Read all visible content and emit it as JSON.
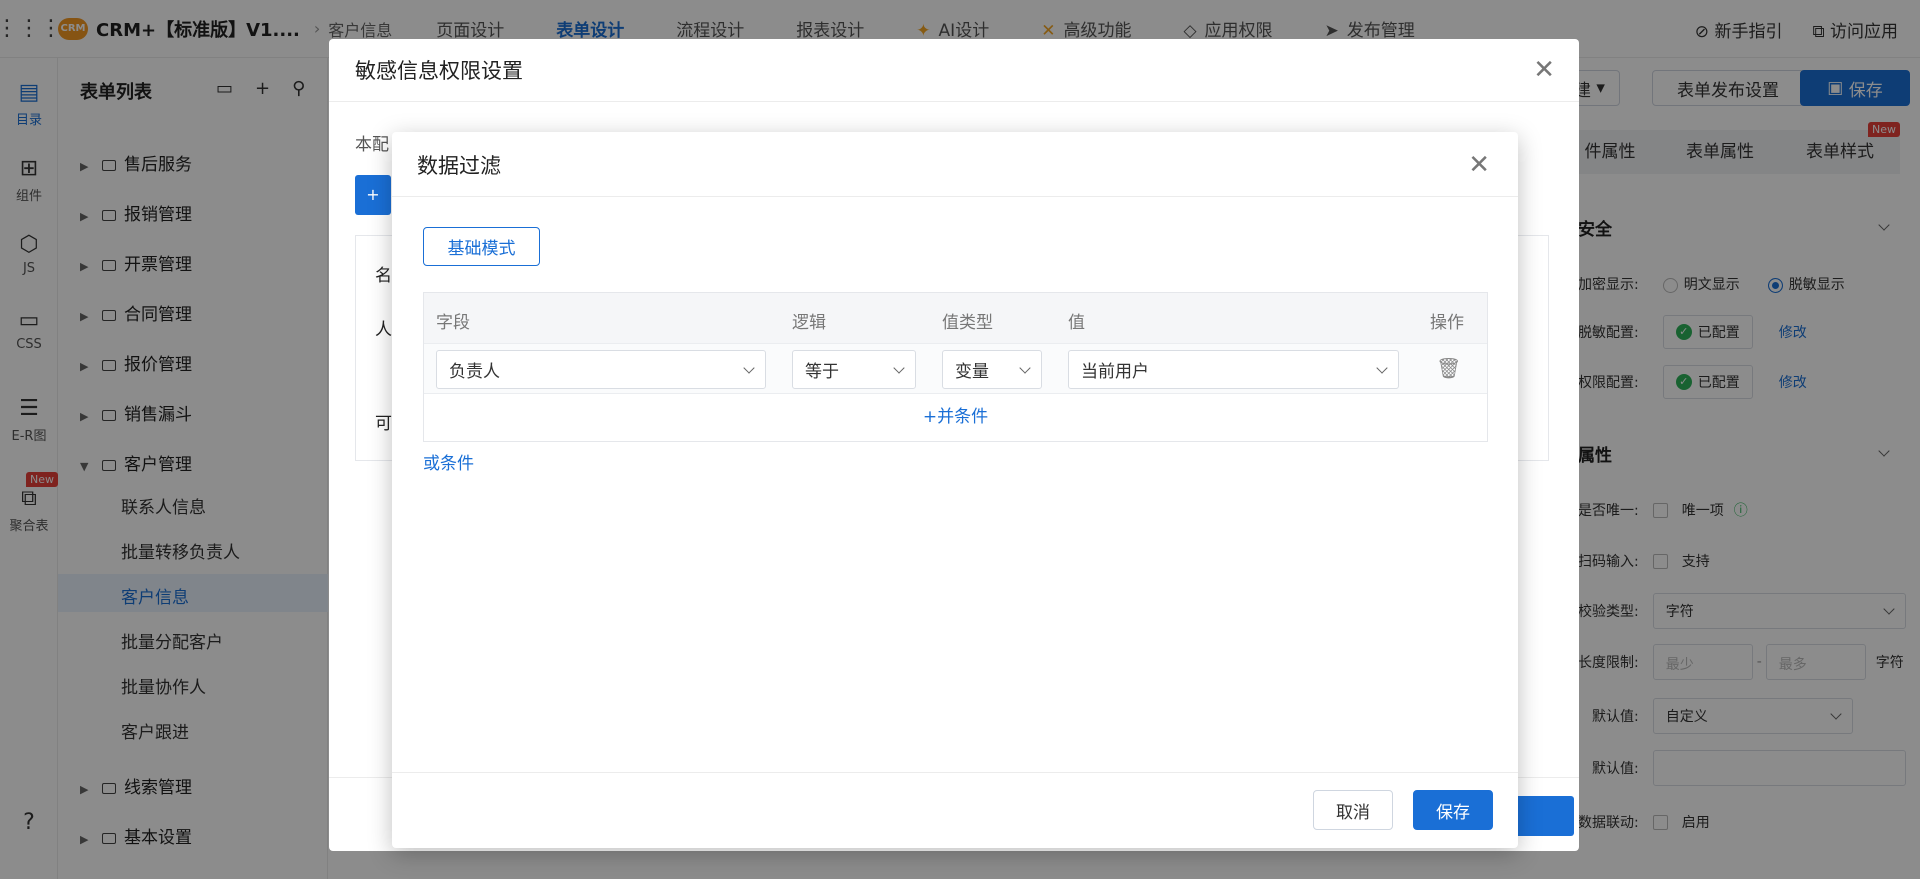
{
  "topbar": {
    "app_title": "CRM+【标准版】V1....",
    "logo": "CRM",
    "crumb": "客户信息",
    "nav": [
      "页面设计",
      "表单设计",
      "流程设计",
      "报表设计",
      "AI设计",
      "高级功能",
      "应用权限",
      "发布管理"
    ],
    "guide": "新手指引",
    "visit": "访问应用"
  },
  "leftbar": [
    {
      "label": "目录",
      "icon": "catalog-icon"
    },
    {
      "label": "组件",
      "icon": "component-icon"
    },
    {
      "label": "JS",
      "icon": "js-icon"
    },
    {
      "label": "CSS",
      "icon": "css-icon"
    },
    {
      "label": "E-R图",
      "icon": "er-icon"
    },
    {
      "label": "聚合表",
      "icon": "aggregate-icon",
      "badge": "New"
    }
  ],
  "tree": {
    "title": "表单列表",
    "folders": [
      "售后服务",
      "报销管理",
      "开票管理",
      "合同管理",
      "报价管理",
      "销售漏斗",
      "客户管理"
    ],
    "leaves": [
      "联系人信息",
      "批量转移负责人",
      "客户信息",
      "批量分配客户",
      "批量协作人",
      "客户跟进"
    ],
    "selected": "客户信息",
    "folders_after": [
      "线索管理",
      "基本设置"
    ]
  },
  "right": {
    "btn_new": "建",
    "btn_publish": "表单发布设置",
    "btn_save": "保存",
    "tabs": [
      "件属性",
      "表单属性",
      "表单样式"
    ],
    "tab_new": "New",
    "sec_security": "安全",
    "encrypt_label": "加密显示:",
    "opt_plain": "明文显示",
    "opt_mask": "脱敏显示",
    "mask_label": "脱敏配置:",
    "perm_label": "权限配置:",
    "configured": "已配置",
    "edit": "修改",
    "sec_attr": "属性",
    "unique_label": "是否唯一:",
    "unique_opt": "唯一项",
    "scan_label": "扫码输入:",
    "scan_opt": "支持",
    "check_label": "校验类型:",
    "check_val": "字符",
    "len_label": "长度限制:",
    "len_min": "最少",
    "len_max": "最多",
    "len_unit": "字符",
    "def_label": "默认值:",
    "def_val": "自定义",
    "def2_label": "默认值:",
    "link_label": "数据联动:",
    "link_opt": "启用"
  },
  "dialog1": {
    "title": "敏感信息权限设置",
    "bg_text1": "本配",
    "bg_text2": "名",
    "bg_text3": "人",
    "bg_text4": "可"
  },
  "dialog2": {
    "title": "数据过滤",
    "mode_btn": "基础模式",
    "headers": [
      "字段",
      "逻辑",
      "值类型",
      "值",
      "操作"
    ],
    "row": {
      "field": "负责人",
      "logic": "等于",
      "type": "变量",
      "value": "当前用户"
    },
    "add_and": "+并条件",
    "add_or": "或条件",
    "cancel": "取消",
    "save": "保存"
  }
}
